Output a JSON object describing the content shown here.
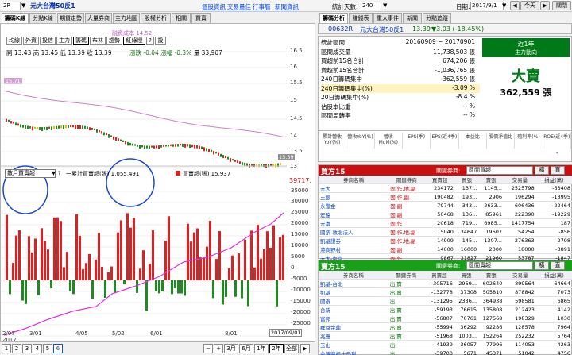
{
  "toolbar": {
    "code_value": "2R",
    "stock_title": "元大台灣50反1",
    "links": [
      "個股資訊",
      "交易量佳",
      "行事曆",
      "新聞資訊"
    ],
    "days_label": "統計天數:",
    "days_value": "240",
    "date_label": "日期:",
    "date_value": "2017/9/1",
    "today_btn": "今天",
    "close_btn": "關閉"
  },
  "left_tabs": [
    "籌碼K線",
    "分點K線",
    "期貨走勢",
    "大量券商",
    "主力地圖",
    "股權分析",
    "相關",
    "買賣"
  ],
  "indicators": [
    "均線",
    "外資",
    "投信",
    "主力",
    "籌碼",
    "布林",
    "趨勢",
    "紅綠燈",
    "?",
    "設"
  ],
  "indicator_active": [
    "籌碼",
    "紅綠燈"
  ],
  "ohlc": {
    "open": "開 13.43",
    "high": "高 13.45",
    "low": "低 13.39",
    "close": "收 13.39",
    "change": "漲跌 -0.04",
    "pct": "漲幅 -0.3%",
    "vol": "量 33,907"
  },
  "cost_label": "融資成本 14.52",
  "left_marker": "15.71",
  "right_marker": "13.39",
  "price_ticks": [
    "16.5",
    "16",
    "15.5",
    "15",
    "14.5",
    "14",
    "13.5",
    "13"
  ],
  "vol_ticks": [
    "39717.",
    "35000",
    "30000",
    "25000",
    "20000",
    "15000",
    "10000",
    "5000",
    "0",
    "-5000",
    "-10000",
    "-15000",
    "-20000",
    "-25000"
  ],
  "x_labels": [
    "2/07",
    "3/01",
    "4/05",
    "5/02",
    "6/01",
    "8/01"
  ],
  "x_year": "2017",
  "end_date": "2017/09/01",
  "sub_select": "散戶買賣超",
  "legend1": "一累計買賣超(張) 1,055,491",
  "legend2": "買賣超(張) 15,937",
  "pages": [
    "1",
    "2",
    "3",
    "4",
    "5",
    "6"
  ],
  "page_active": "6",
  "periods": [
    "3月",
    "6月",
    "1年",
    "2年",
    "全部"
  ],
  "period_active": "2年",
  "right_tabs": [
    "籌碼分析",
    "賺錢表",
    "重大事件",
    "新聞",
    "分點追蹤"
  ],
  "header": {
    "code": "00632R",
    "name": "元大台灣50反1",
    "price": "13.39",
    "change": "▼3.03 (-18.45%)"
  },
  "stats": [
    {
      "label": "統計區間",
      "value": "20160909 ~ 20170901"
    },
    {
      "label": "區間成交量",
      "value": "11,738,503 張"
    },
    {
      "label": "買超前15名合計",
      "value": "674,206 張"
    },
    {
      "label": "賣超前15名合計",
      "value": "-1,036,765 張"
    },
    {
      "label": "240日籌碼集中",
      "value": "-362,559 張"
    },
    {
      "label": "240日籌碼集中(%)",
      "value": "-3.09 %"
    },
    {
      "label": "20日籌碼集中(%)",
      "value": "-8.4 %"
    },
    {
      "label": "佔股本比重",
      "value": "-- %"
    },
    {
      "label": "區間周轉率",
      "value": "-- %"
    }
  ],
  "trend": {
    "title1": "近1年",
    "title2": "主力動向",
    "big": "大賣",
    "value": "362,559 張"
  },
  "metrics": [
    "累計營收YoY(%)",
    "營收YoY(%)",
    "營收MoM(%)",
    "EPS(季)",
    "EPS(近4季)",
    "本益比",
    "股價淨值比",
    "殖利率(%)",
    "ROE(近4季)"
  ],
  "metrics_vals": [
    "",
    "",
    "",
    "",
    "",
    "",
    "",
    "",
    "-"
  ],
  "buy": {
    "title": "買方15",
    "sort_label": "關鍵券商:",
    "sort_value": "區間買超",
    "cols": [
      "券商名稱",
      "關鍵券商",
      "買賣超",
      "買張",
      "賣張",
      "交易量",
      "損益(萬)"
    ],
    "rows": [
      [
        "元大",
        "固,作,地,副",
        "234172",
        "137...",
        "1145...",
        "2525798",
        "-63408"
      ],
      [
        "土銀",
        "固,作,副",
        "190482",
        "193...",
        "2906",
        "196294",
        "-18995"
      ],
      [
        "永豐金",
        "固,副",
        "79744",
        "343...",
        "2633...",
        "606436",
        "-22464"
      ],
      [
        "宏遠",
        "固,副",
        "50468",
        "136...",
        "85961",
        "222390",
        "-19229"
      ],
      [
        "元富",
        "固,作",
        "20618",
        "719...",
        "6985...",
        "1417754",
        "187"
      ],
      [
        "國票-敦北法人",
        "固,作,地,副",
        "15040",
        "34647",
        "19607",
        "54254",
        "-856"
      ],
      [
        "凱基證券",
        "固,作,地,副",
        "14909",
        "145...",
        "1307...",
        "276363",
        "2798"
      ],
      [
        "港商野村",
        "固,副",
        "14000",
        "16000",
        "2000",
        "18000",
        "-3891"
      ],
      [
        "元大-南京",
        "固,作",
        "9867",
        "31827",
        "21960",
        "53787",
        "-1847"
      ]
    ]
  },
  "sell": {
    "title": "賣方15",
    "sort_label": "關鍵券商:",
    "sort_value": "區間賣超",
    "cols": [
      "券商名稱",
      "關鍵券商",
      "買賣超",
      "買張",
      "賣張",
      "交易量",
      "損益(萬)"
    ],
    "rows": [
      [
        "凱基-台北",
        "出,賣",
        "-305716",
        "2969...",
        "602640",
        "899564",
        "64664"
      ],
      [
        "凱基",
        "出,賣",
        "-132778",
        "37308",
        "505810",
        "878842",
        "7073"
      ],
      [
        "國泰",
        "出",
        "-131295",
        "2336...",
        "364938",
        "598581",
        "6865"
      ],
      [
        "台新",
        "出,賣",
        "-59193",
        "76615",
        "135808",
        "212423",
        "4142"
      ],
      [
        "富邦",
        "出,賣",
        "-56807",
        "70761",
        "127568",
        "198329",
        "1030"
      ],
      [
        "群益金鼎",
        "出,賣",
        "-55994",
        "36292",
        "92286",
        "128578",
        "7964"
      ],
      [
        "兆豐",
        "出,賣",
        "-51968",
        "1003...",
        "152264",
        "252232",
        "5764"
      ],
      [
        "玉山",
        "出",
        "-41939",
        "36057",
        "77996",
        "114053",
        "4263"
      ],
      [
        "台灣摩根士丹利",
        "出",
        "-39700",
        "5671",
        "45371",
        "51042",
        "4756"
      ]
    ]
  },
  "colors": {
    "up": "#e02020",
    "down": "#208a20",
    "accent": "#c81010",
    "link": "#0040e0",
    "ma": "#d080c8",
    "cum": "#e030e0"
  }
}
